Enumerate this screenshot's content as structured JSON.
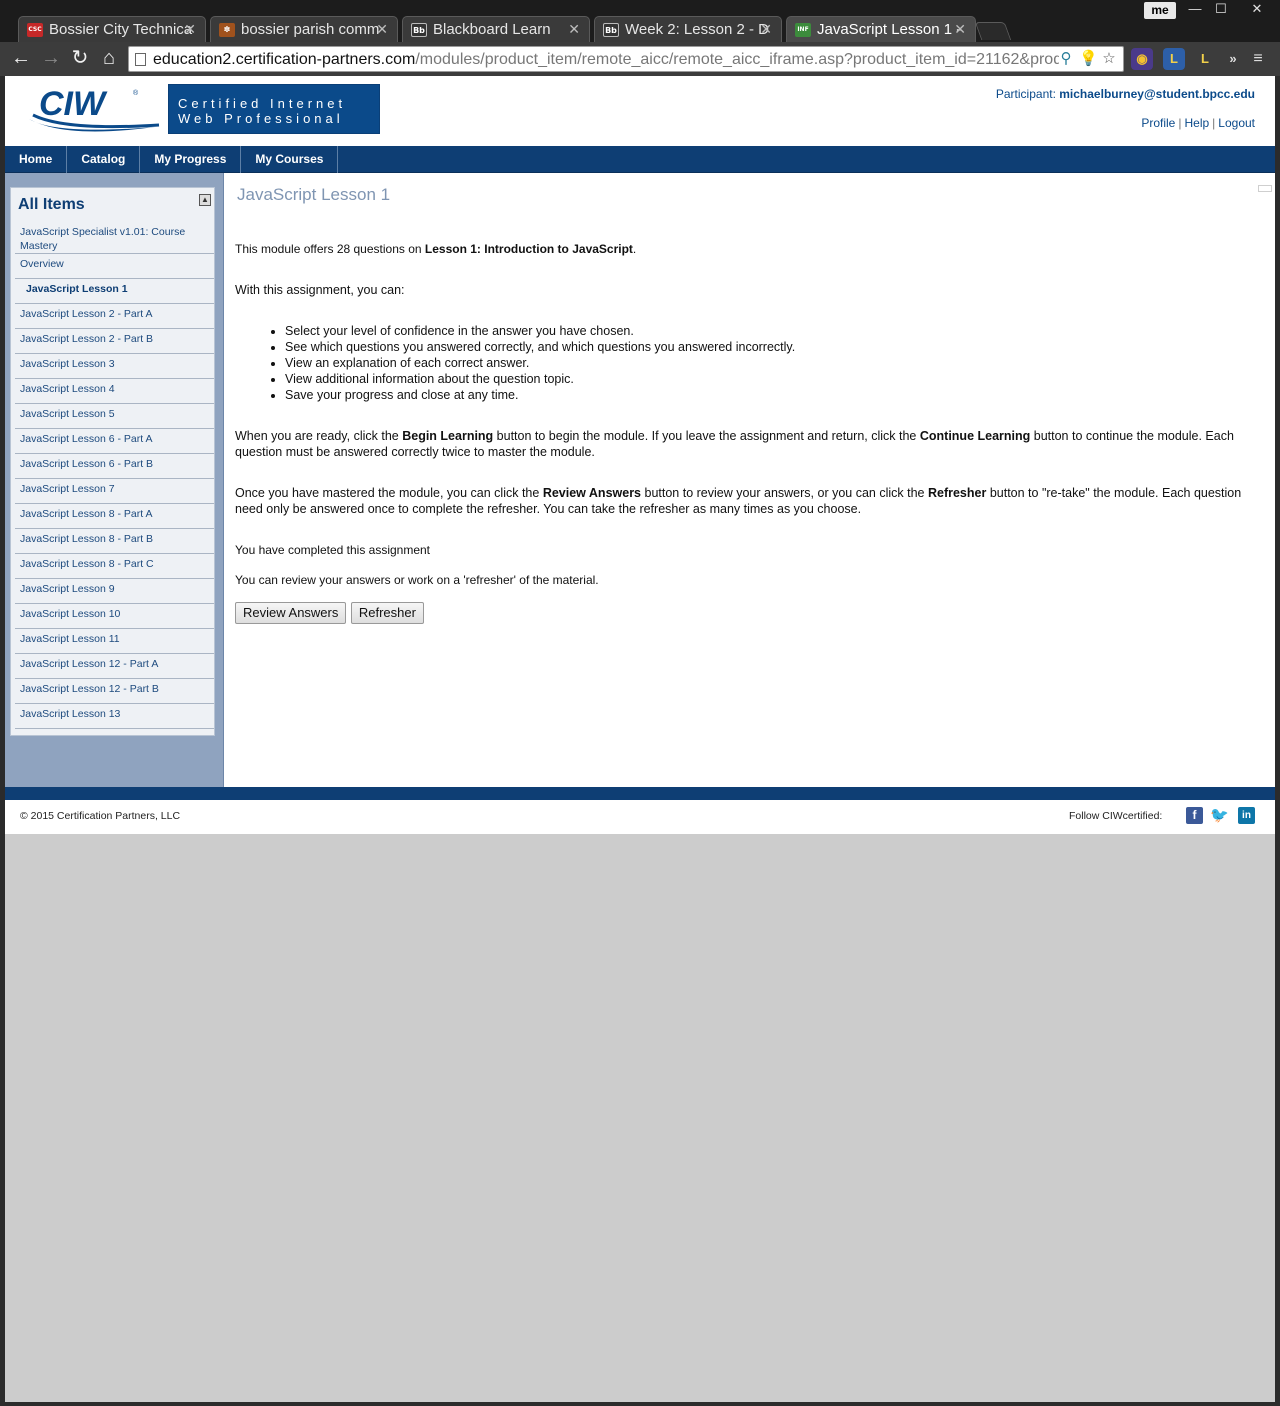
{
  "browser": {
    "tabs": [
      {
        "title": "Bossier City Technica",
        "favicon": "CSC",
        "favicon_color": "#c62828"
      },
      {
        "title": "bossier parish comm",
        "favicon": "✽",
        "favicon_color": "#a0521d"
      },
      {
        "title": "Blackboard Learn",
        "favicon": "Bb",
        "favicon_color": "#333333"
      },
      {
        "title": "Week 2: Lesson 2 - D",
        "favicon": "Bb",
        "favicon_color": "#333333"
      },
      {
        "title": "JavaScript Lesson 1 -",
        "favicon": "INF",
        "favicon_color": "#3c8c3c"
      }
    ],
    "active_tab": 4,
    "profile_label": "me",
    "url_host": "education2.certification-partners.com",
    "url_path": "/modules/product_item/remote_aicc/remote_aicc_iframe.asp?product_item_id=21162&prod"
  },
  "header": {
    "banner_line1": "Certified Internet",
    "banner_line2": "Web Professional",
    "participant_label": "Participant:",
    "participant_email": "michaelburney@student.bpcc.edu",
    "links": [
      "Profile",
      "Help",
      "Logout"
    ]
  },
  "nav": [
    "Home",
    "Catalog",
    "My Progress",
    "My Courses"
  ],
  "sidebar": {
    "title": "All Items",
    "items": [
      "JavaScript Specialist v1.01: Course Mastery",
      "Overview",
      "JavaScript Lesson 1",
      "JavaScript Lesson 2 - Part A",
      "JavaScript Lesson 2 - Part B",
      "JavaScript Lesson 3",
      "JavaScript Lesson 4",
      "JavaScript Lesson 5",
      "JavaScript Lesson 6 - Part A",
      "JavaScript Lesson 6 - Part B",
      "JavaScript Lesson 7",
      "JavaScript Lesson 8 - Part A",
      "JavaScript Lesson 8 - Part B",
      "JavaScript Lesson 8 - Part C",
      "JavaScript Lesson 9",
      "JavaScript Lesson 10",
      "JavaScript Lesson 11",
      "JavaScript Lesson 12 - Part A",
      "JavaScript Lesson 12 - Part B",
      "JavaScript Lesson 13"
    ],
    "active_index": 2
  },
  "main": {
    "title": "JavaScript Lesson 1",
    "intro_pre": "This module offers 28 questions on ",
    "intro_bold": "Lesson 1: Introduction to JavaScript",
    "intro_post": ".",
    "with_text": "With this assignment, you can:",
    "bullets": [
      "Select your level of confidence in the answer you have chosen.",
      "See which questions you answered correctly, and which questions you answered incorrectly.",
      "View an explanation of each correct answer.",
      "View additional information about the question topic.",
      "Save your progress and close at any time."
    ],
    "ready_1": "When you are ready, click the ",
    "ready_b1": "Begin Learning",
    "ready_2": " button to begin the module. If you leave the assignment and return, click the ",
    "ready_b2": "Continue Learning",
    "ready_3": " button to continue the module. Each question must be answered correctly twice to master the module.",
    "mastered_1": "Once you have mastered the module, you can click the ",
    "mastered_b1": "Review Answers",
    "mastered_2": " button to review your answers, or you can click the ",
    "mastered_b2": "Refresher",
    "mastered_3": " button to \"re-take\" the module. Each question need only be answered once to complete the refresher. You can take the refresher as many times as you choose.",
    "completed": "You have completed this assignment",
    "review_text": "You can review your answers or work on a 'refresher' of the material.",
    "buttons": [
      "Review Answers",
      "Refresher"
    ]
  },
  "footer": {
    "copyright": "© 2015 Certification Partners, LLC",
    "follow": "Follow CIWcertified:"
  },
  "colors": {
    "brand_navy": "#0e3e74",
    "brand_blue": "#0b4a8a",
    "sidebar_bg": "#8fa3bf"
  }
}
